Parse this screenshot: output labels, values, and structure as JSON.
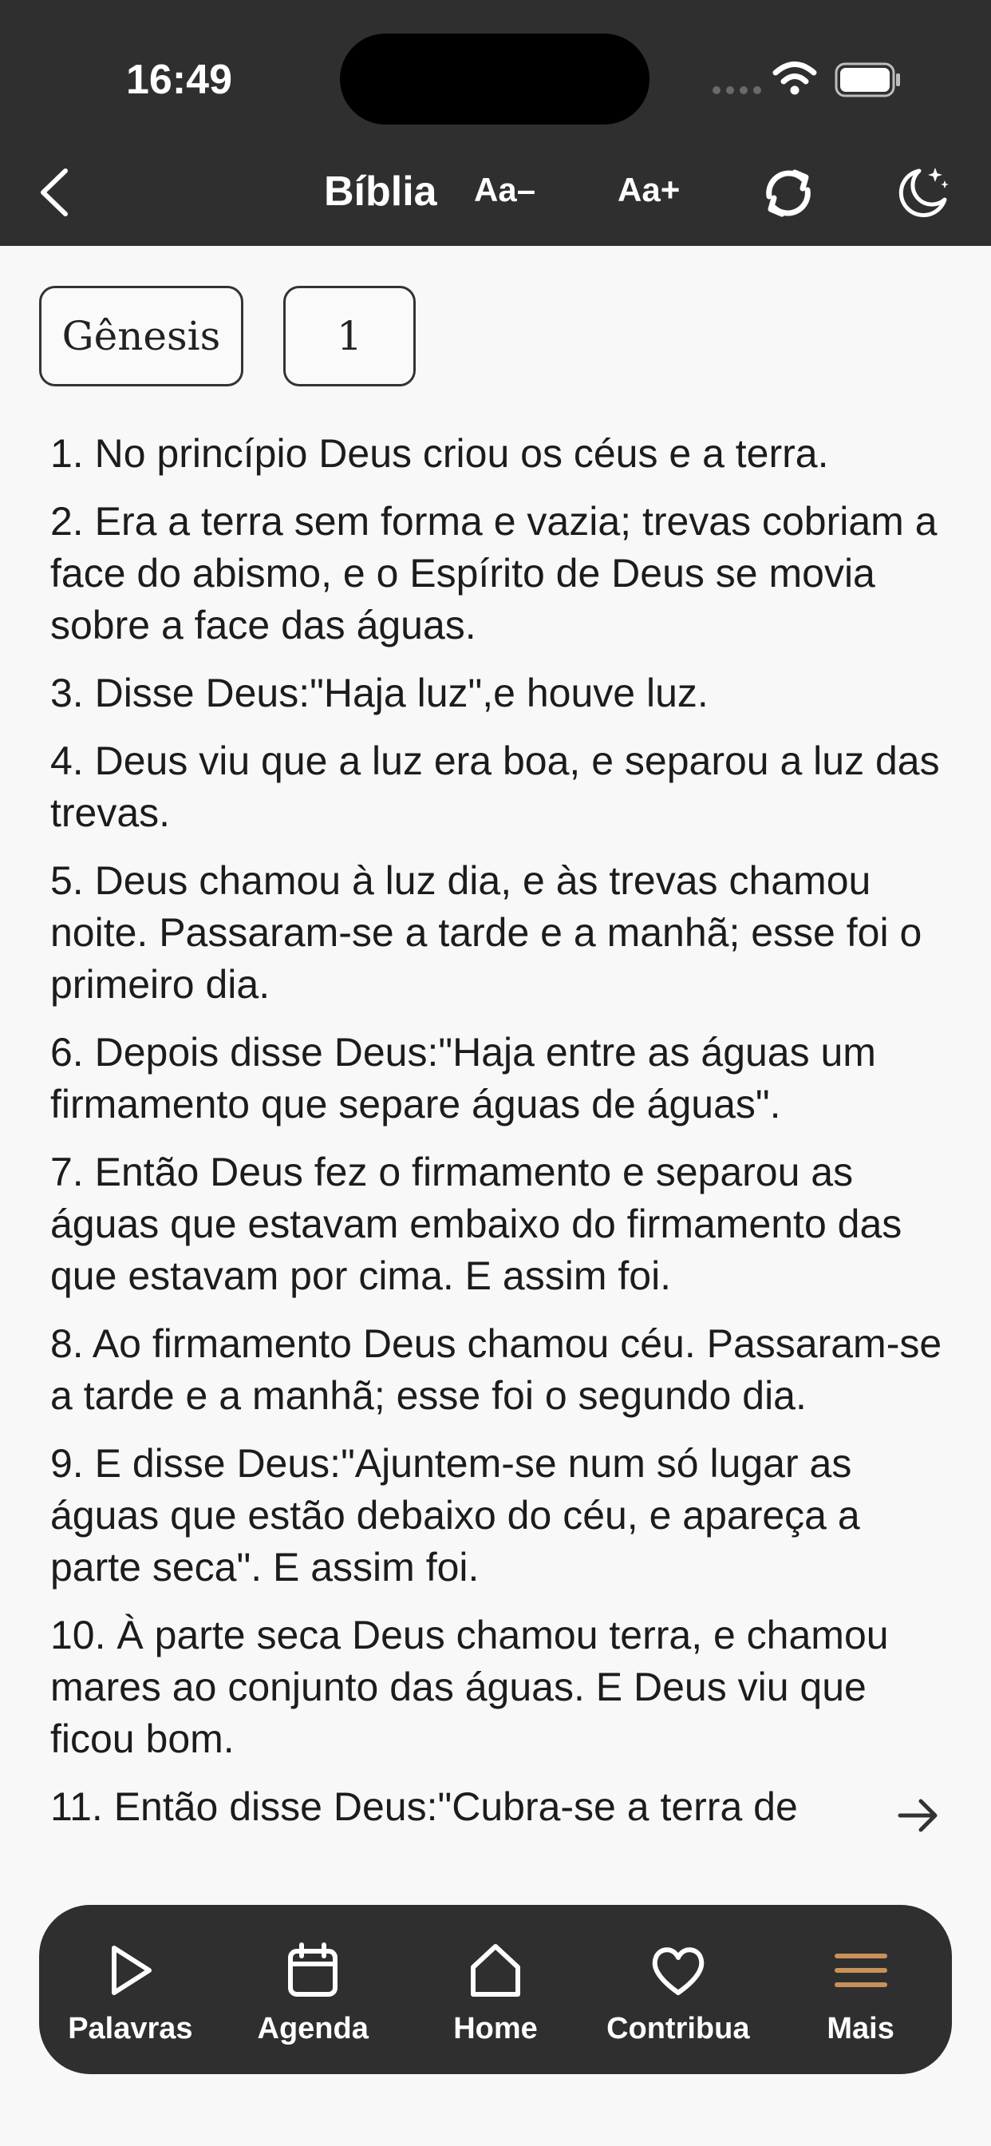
{
  "status_bar": {
    "time": "16:49"
  },
  "header": {
    "title": "Bíblia",
    "font_decrease_label": "Aa–",
    "font_increase_label": "Aa+"
  },
  "selectors": {
    "book": "Gênesis",
    "chapter": "1"
  },
  "verses": [
    "1. No princípio Deus criou os céus e a terra.",
    "2. Era a terra sem forma e vazia; trevas cobriam a face do abismo, e o Espírito de Deus se movia sobre a face das águas.",
    "3. Disse Deus:\"Haja luz\",e houve luz.",
    "4. Deus viu que a luz era boa, e separou a luz das trevas.",
    "5. Deus chamou à luz dia, e às trevas chamou noite. Passaram-se a tarde e a manhã; esse foi o primeiro dia.",
    "6. Depois disse Deus:\"Haja entre as águas um firmamento que separe águas de águas\".",
    "7. Então Deus fez o firmamento e separou as águas que estavam embaixo do firmamento das que estavam por cima. E assim foi.",
    "8. Ao firmamento Deus chamou céu. Passaram-se a tarde e a manhã; esse foi o segundo dia.",
    "9. E disse Deus:\"Ajuntem-se num só lugar as águas que estão debaixo do céu, e apareça a parte seca\". E assim foi.",
    "10. À parte seca Deus chamou terra, e chamou mares ao conjunto das águas. E Deus viu que ficou bom.",
    "11. Então disse Deus:\"Cubra-se a terra de"
  ],
  "tabbar": {
    "items": [
      {
        "label": "Palavras",
        "icon": "play-icon"
      },
      {
        "label": "Agenda",
        "icon": "calendar-icon"
      },
      {
        "label": "Home",
        "icon": "home-icon"
      },
      {
        "label": "Contribua",
        "icon": "heart-icon"
      },
      {
        "label": "Mais",
        "icon": "menu-icon"
      }
    ],
    "active_index": 4,
    "accent_color": "#c8915a"
  },
  "colors": {
    "header_bg": "#2f2f2f",
    "page_bg": "#f8f8f8",
    "text": "#1c1c1c"
  }
}
